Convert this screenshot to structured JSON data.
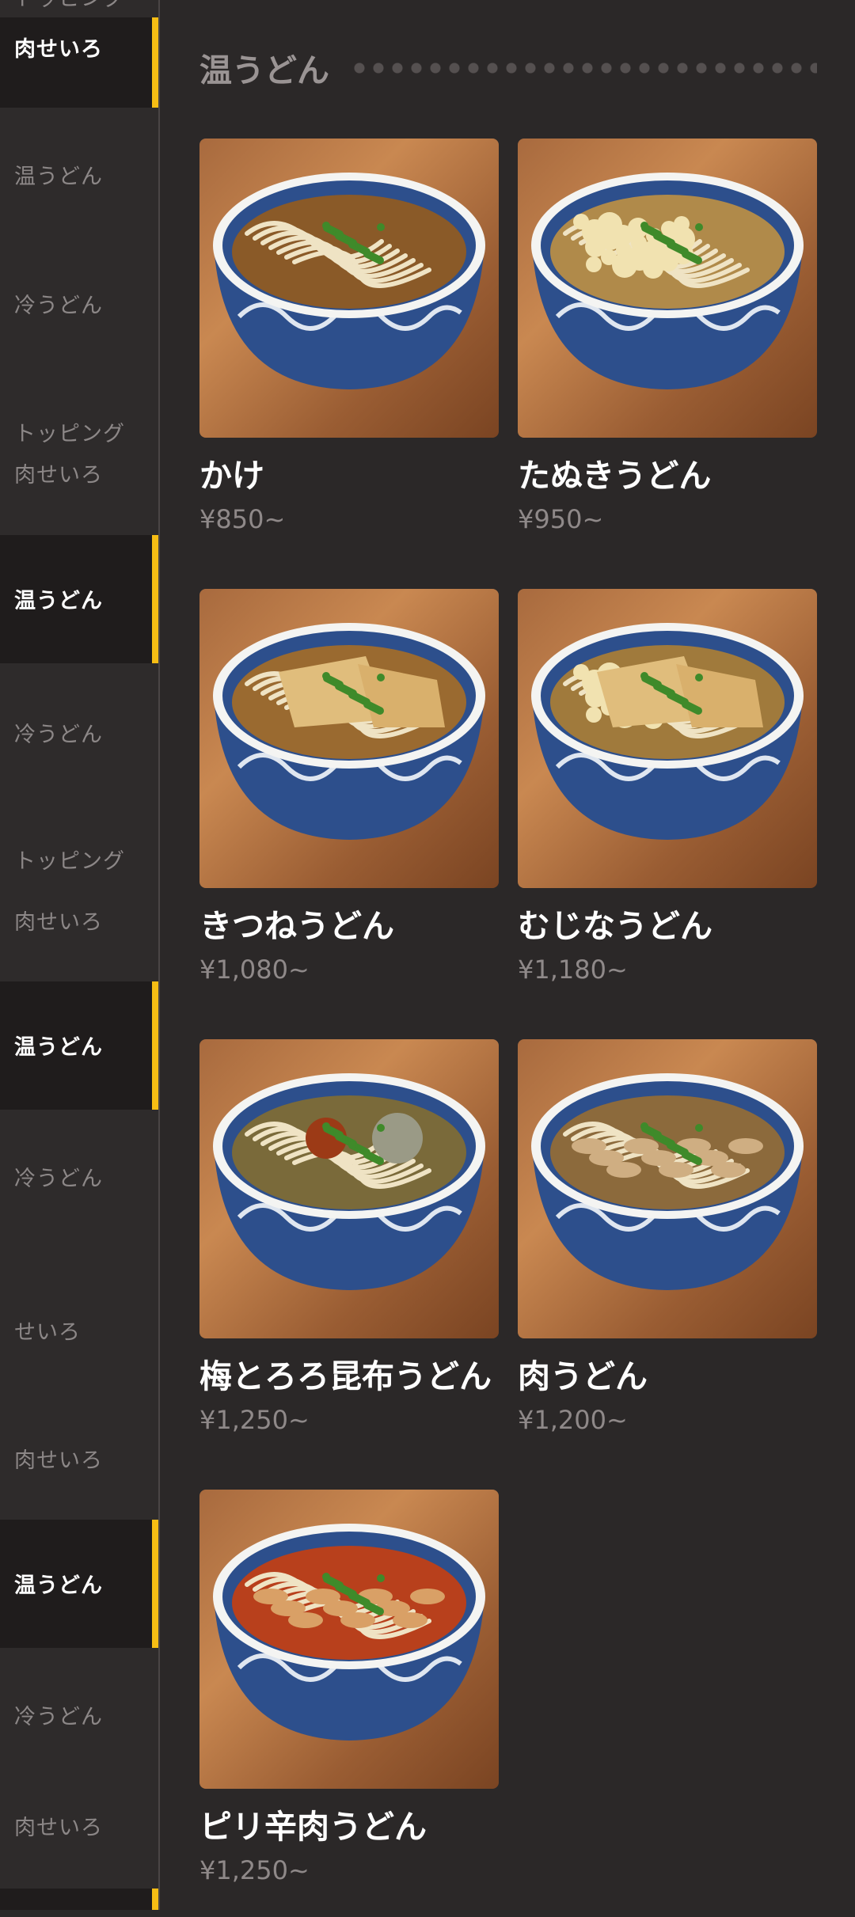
{
  "sidebar": {
    "items": [
      {
        "label": "トッピング",
        "active": false
      },
      {
        "label": "肉せいろ",
        "active": true
      },
      {
        "label": "温うどん",
        "active": false
      },
      {
        "label": "冷うどん",
        "active": false
      },
      {
        "label": "トッピング",
        "active": false
      },
      {
        "label": "肉せいろ",
        "active": false
      },
      {
        "label": "温うどん",
        "active": true
      },
      {
        "label": "冷うどん",
        "active": false
      },
      {
        "label": "トッピング",
        "active": false
      },
      {
        "label": "肉せいろ",
        "active": false
      },
      {
        "label": "温うどん",
        "active": true
      },
      {
        "label": "冷うどん",
        "active": false
      },
      {
        "label": "せいろ",
        "active": false
      },
      {
        "label": "肉せいろ",
        "active": false
      },
      {
        "label": "温うどん",
        "active": true
      },
      {
        "label": "冷うどん",
        "active": false
      },
      {
        "label": "肉せいろ",
        "active": false
      }
    ]
  },
  "section": {
    "title": "温うどん"
  },
  "menu": {
    "items": [
      {
        "name": "かけ",
        "price": "¥850~",
        "topping": "negi"
      },
      {
        "name": "たぬきうどん",
        "price": "¥950~",
        "topping": "tenkasu"
      },
      {
        "name": "きつねうどん",
        "price": "¥1,080~",
        "topping": "age"
      },
      {
        "name": "むじなうどん",
        "price": "¥1,180~",
        "topping": "age-tenkasu"
      },
      {
        "name": "梅とろろ昆布うどん",
        "price": "¥1,250~",
        "topping": "ume"
      },
      {
        "name": "肉うどん",
        "price": "¥1,200~",
        "topping": "meat"
      },
      {
        "name": "ピリ辛肉うどん",
        "price": "¥1,250~",
        "topping": "spicy"
      }
    ]
  },
  "colors": {
    "accent": "#f7bd14",
    "background": "#2b2828",
    "sidebar": "#2e2b2b",
    "active": "#1f1c1c"
  }
}
